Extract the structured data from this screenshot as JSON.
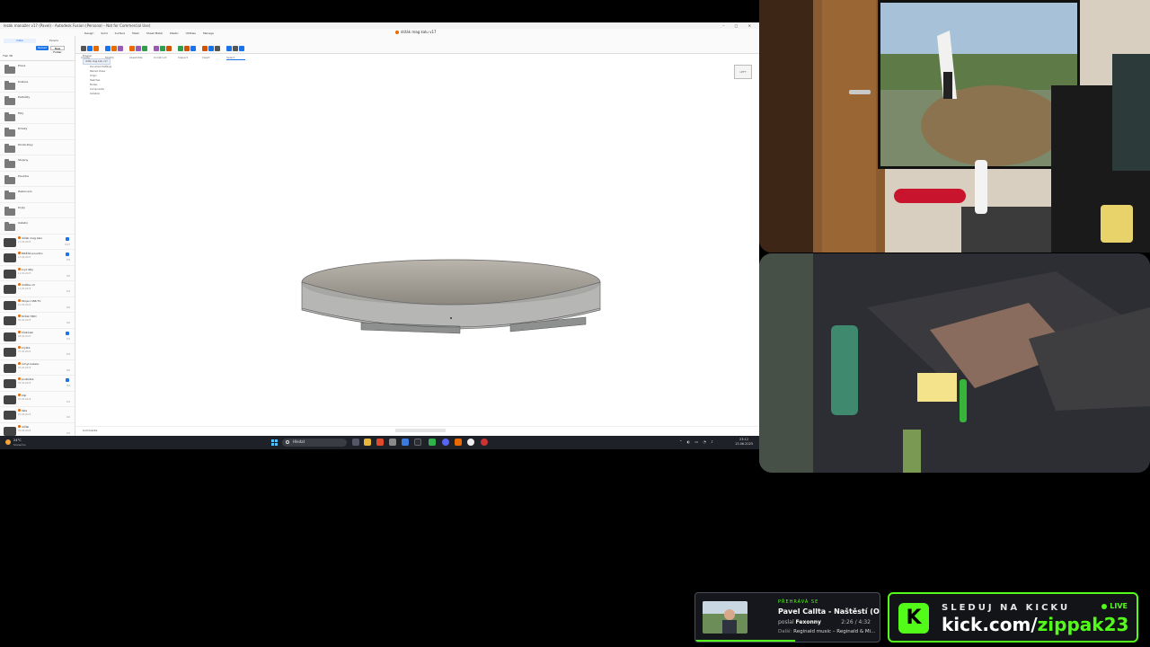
{
  "fusion": {
    "title": "lezák manažer v17 (Pavel) - Autodesk Fusion (Personal – Not for Commercial Use)",
    "doc_tab": "držák mag kalu v17",
    "tabs": [
      "Design",
      "Solid",
      "Surface",
      "Mesh",
      "Sheet Metal",
      "Plastic",
      "Utilities",
      "Manage"
    ],
    "ribbon": [
      "Create",
      "Modify",
      "Assemble",
      "Construct",
      "Inspect",
      "Insert",
      "Select"
    ],
    "data_panel": {
      "seg_data": "Data",
      "seg_people": "People",
      "upload": "Upload",
      "new_folder": "New Folder",
      "project": "Tisk 3D",
      "folders": [
        "Praca",
        "Krabice",
        "Podložky",
        "Filty",
        "Drzaky",
        "Dioda klipy",
        "Stojany",
        "Pouzdra",
        "Zakonceni",
        "Kryty",
        "Ostatní"
      ],
      "parts": [
        {
          "name": "držák mag kalu",
          "date": "13.06.2025",
          "ver": "V17",
          "badge": true
        },
        {
          "name": "DRŽÁK pouzdro",
          "date": "13.06.2025",
          "ver": "V4",
          "badge": true
        },
        {
          "name": "kryt lišty",
          "date": "12.06.2025",
          "ver": "V2",
          "badge": false
        },
        {
          "name": "drážka v3",
          "date": "12.06.2025",
          "ver": "V3",
          "badge": false
        },
        {
          "name": "Stojan USB TV",
          "date": "10.06.2025",
          "ver": "V5",
          "badge": false
        },
        {
          "name": "Držák HDD",
          "date": "09.06.2025",
          "ver": "V2",
          "badge": false
        },
        {
          "name": "hřebínek",
          "date": "08.06.2025",
          "ver": "V1",
          "badge": true
        },
        {
          "name": "krytka",
          "date": "07.06.2025",
          "ver": "V3",
          "badge": false
        },
        {
          "name": "úchyt kabelu",
          "date": "06.06.2025",
          "ver": "V2",
          "badge": false
        },
        {
          "name": "podložka",
          "date": "05.06.2025",
          "ver": "V4",
          "badge": true
        },
        {
          "name": "klip",
          "date": "04.06.2025",
          "ver": "V1",
          "badge": false
        },
        {
          "name": "lišta",
          "date": "03.06.2025",
          "ver": "V2",
          "badge": false
        },
        {
          "name": "držák",
          "date": "02.06.2025",
          "ver": "V1",
          "badge": false
        }
      ]
    },
    "browser": [
      "Browser",
      "držák mag kalu v17",
      "Document Settings",
      "Named Views",
      "Origin",
      "Sketches",
      "Bodies",
      "Components",
      "Ovládání"
    ],
    "viewcube": "LEFT",
    "comments": "Comments",
    "timeline": "|◀ ◀ ▶ ▶|"
  },
  "taskbar": {
    "temp": "24°C",
    "condition": "Slunečno",
    "search": "Hledat",
    "time": "23:12",
    "date": "13.06.2025"
  },
  "music": {
    "now_playing": "PŘEHRÁVÁ SE",
    "song": "Pavel Callta - Naštěstí (O...",
    "by_label": "poslal",
    "by_user": "Fexonny",
    "time": "2:26 / 4:32",
    "next_label": "Další:",
    "next_song": "Reginald music – Reginald & Mi...",
    "progress": 0.54
  },
  "kick": {
    "logo": "K",
    "follow": "SLEDUJ NA KICKU",
    "url_prefix": "kick.com/",
    "url_user": "zippak23",
    "live": "LIVE"
  },
  "colors": {
    "kick_green": "#53fc18",
    "fusion_accent": "#e86a00"
  }
}
